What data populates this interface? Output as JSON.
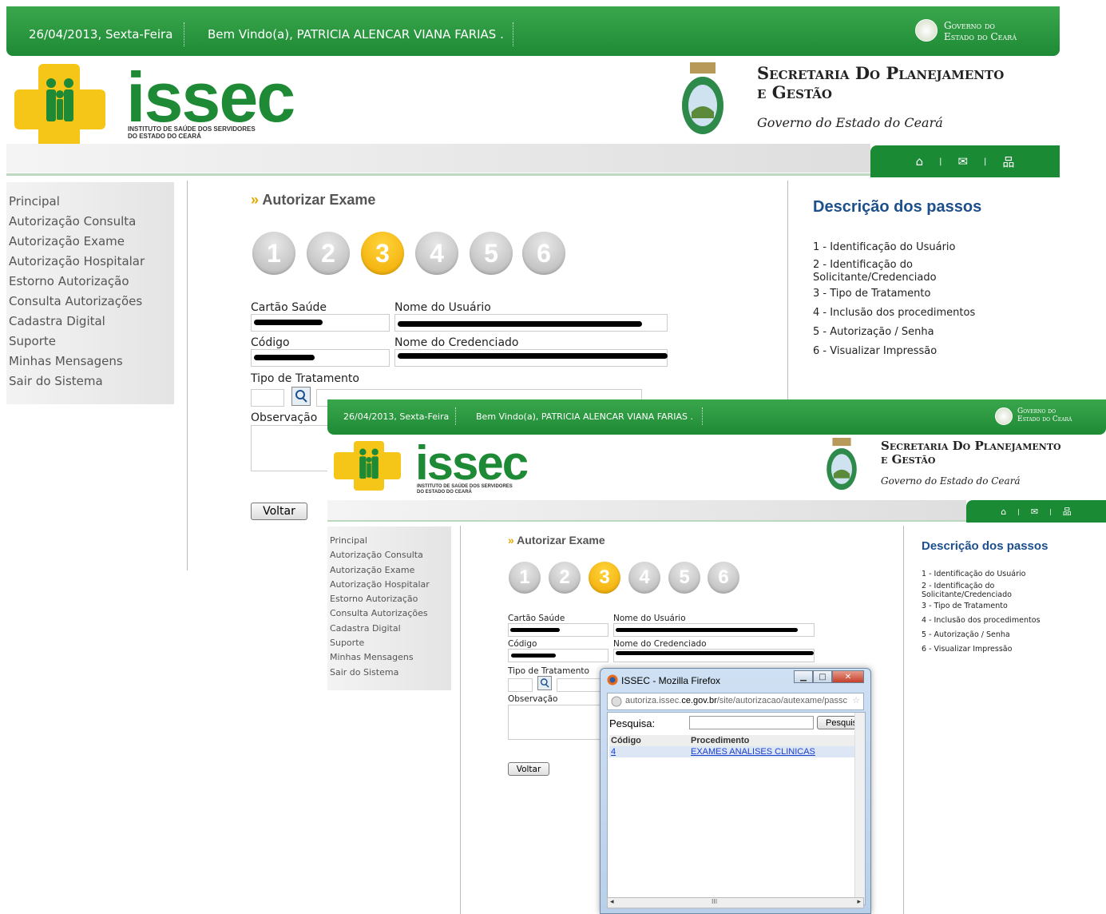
{
  "header": {
    "date": "26/04/2013, Sexta-Feira",
    "welcome": "Bem Vindo(a), PATRICIA ALENCAR VIANA FARIAS .",
    "gov_line1": "Governo do",
    "gov_line2": "Estado do Ceará"
  },
  "brand": {
    "logo_text": "issec",
    "logo_sub1": "INSTITUTO DE SAÚDE DOS SERVIDORES",
    "logo_sub2": "DO ESTADO DO CEARÁ",
    "secretaria_line1": "Secretaria Do Planejamento",
    "secretaria_line2": "e Gestão",
    "secretaria_sub": "Governo do Estado do Ceará"
  },
  "iconbar": {
    "home_icon": "⌂",
    "sep": "|",
    "mail_icon": "✉",
    "sitemap_icon": "品"
  },
  "sidebar": {
    "items": [
      {
        "label": "Principal"
      },
      {
        "label": "Autorização Consulta"
      },
      {
        "label": "Autorização Exame"
      },
      {
        "label": "Autorização Hospitalar"
      },
      {
        "label": "Estorno Autorização"
      },
      {
        "label": "Consulta Autorizações"
      },
      {
        "label": "Cadastra Digital"
      },
      {
        "label": "Suporte"
      },
      {
        "label": "Minhas Mensagens"
      },
      {
        "label": "Sair do Sistema"
      }
    ]
  },
  "main": {
    "title_arrow": "»",
    "title": "Autorizar Exame",
    "steps": [
      "1",
      "2",
      "3",
      "4",
      "5",
      "6"
    ],
    "active_step": 3,
    "cartao_label": "Cartão Saúde",
    "nome_usuario_label": "Nome do Usuário",
    "codigo_label": "Código",
    "nome_credenciado_label": "Nome do Credenciado",
    "tipo_label": "Tipo de Tratamento",
    "obs_label": "Observação",
    "voltar": "Voltar"
  },
  "description": {
    "title": "Descrição dos passos",
    "items": [
      "1 - Identificação do Usuário",
      "2 - Identificação do",
      "Solicitante/Credenciado",
      "3 - Tipo de Tratamento",
      "4 - Inclusão dos procedimentos",
      "5 - Autorização / Senha",
      "6 - Visualizar Impressão"
    ]
  },
  "popup": {
    "title": "ISSEC - Mozilla Firefox",
    "url_host": "autoriza.issec.",
    "url_domain": "ce.gov.br",
    "url_path": "/site/autorizacao/autexame/passc",
    "search_label": "Pesquisa:",
    "search_button": "Pesquisar",
    "col_codigo": "Código",
    "col_procedimento": "Procedimento",
    "row_codigo": "4",
    "row_procedimento": "EXAMES ANALISES CLINICAS",
    "scroll_mark": "III"
  },
  "colors": {
    "green": "#1e8a35",
    "yellow": "#f5c518",
    "blue_title": "#1c4f8c"
  }
}
